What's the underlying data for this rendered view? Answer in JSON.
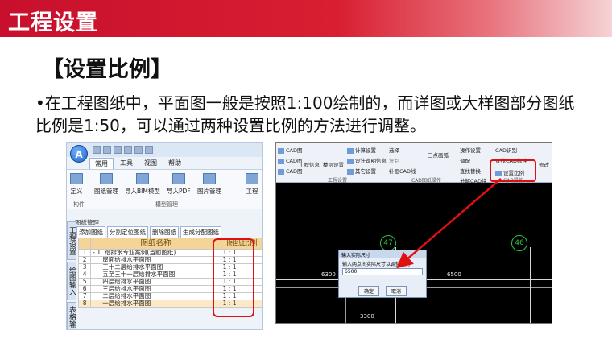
{
  "header": {
    "title": "工程设置"
  },
  "section": {
    "title": "【设置比例】"
  },
  "body": {
    "text": "•在工程图纸中，平面图一般是按照1:100绘制的，而详图或大样图部分图纸比例是1:50，可以通过两种设置比例的方法进行调整。"
  },
  "left_shot": {
    "app_letter": "A",
    "menu": [
      "常用",
      "工具",
      "视图",
      "帮助"
    ],
    "ribbon": {
      "buttons": [
        "定义",
        "图纸管理",
        "导入BIM模型",
        "导入PDF",
        "图片管理",
        "工程"
      ],
      "groups": [
        "构件",
        "模型管理"
      ]
    },
    "panel_title": "图纸管理",
    "tool_buttons": [
      "添加图纸",
      "分割定位图纸",
      "删除图纸",
      "生成分配图纸"
    ],
    "vertical_tabs": [
      "工程设置",
      "绘图输入",
      "表格输"
    ],
    "grid": {
      "headers": [
        "图纸名称",
        "图纸比例"
      ],
      "rows": [
        {
          "idx": "1",
          "name": "- 1. 给排水专业案例(当前图纸)",
          "ratio": "1 : 1"
        },
        {
          "idx": "2",
          "name": "屋面给排水平面图",
          "ratio": "1 : 1"
        },
        {
          "idx": "3",
          "name": "三十二层给排水平面图",
          "ratio": "1 : 1"
        },
        {
          "idx": "4",
          "name": "五至三十一层给排水平面图",
          "ratio": "1 : 1"
        },
        {
          "idx": "5",
          "name": "四层给排水平面图",
          "ratio": "1 : 1"
        },
        {
          "idx": "6",
          "name": "三层给排水平面图",
          "ratio": "1 : 1"
        },
        {
          "idx": "7",
          "name": "二层给排水平面图",
          "ratio": "1 : 1"
        },
        {
          "idx": "8",
          "name": "一层给排水平面图",
          "ratio": "1 : 1"
        }
      ]
    }
  },
  "right_shot": {
    "ribbon_items": [
      "CAD图",
      "CAD图",
      "CAD图",
      "工程信息",
      "楼层设置",
      "计算设置",
      "设计说明信息",
      "其它设置",
      "选择",
      "复制",
      "补画CAD线",
      "三点画弧",
      "操作设置",
      "调配",
      "查找替换",
      "分解CAD块",
      "CAD识别",
      "查找CAD标注",
      "设置比例",
      "修改"
    ],
    "groups": [
      "工程设置",
      "CAD图纸操作",
      "CAD操作"
    ],
    "axes": [
      "47",
      "46"
    ],
    "dims": [
      "6300",
      "6500",
      "3300"
    ],
    "dialog": {
      "title": "输入实际尺寸",
      "label": "输入两点间实际尺寸以调整比例",
      "value": "6500",
      "ok": "确定",
      "cancel": "取消"
    }
  },
  "colors": {
    "brand_red": "#c8102e",
    "highlight_red": "#e01010",
    "grid_header": "#f5d49a",
    "axis_green": "#2fc34a"
  }
}
